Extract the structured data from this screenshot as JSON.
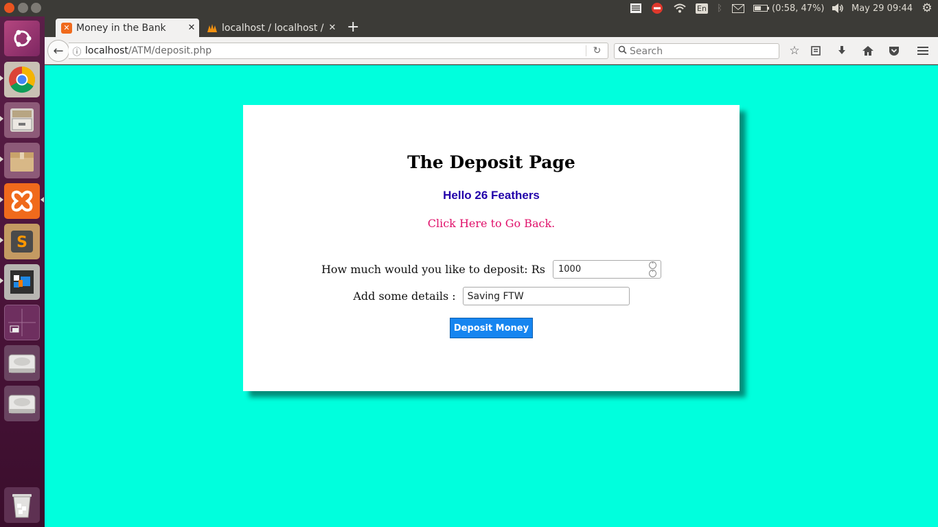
{
  "top_panel": {
    "keyboard_layout": "En",
    "battery": "(0:58, 47%)",
    "clock": "May 29 09:44"
  },
  "launcher": {
    "items": [
      {
        "name": "ubuntu-dash",
        "color": "#a83a74"
      },
      {
        "name": "chrome",
        "color": "#4a8be0"
      },
      {
        "name": "files",
        "color": "#9c9389"
      },
      {
        "name": "archive-manager",
        "color": "#c2a36c"
      },
      {
        "name": "xampp",
        "color": "#f06a1c"
      },
      {
        "name": "sublime-text",
        "color": "#4e4e4e"
      },
      {
        "name": "vm-app",
        "color": "#3c3c3c"
      },
      {
        "name": "workspaces",
        "color": "#6e2f5f"
      },
      {
        "name": "drive-1",
        "color": "#b9b8b6"
      },
      {
        "name": "drive-2",
        "color": "#b9b8b6"
      },
      {
        "name": "trash",
        "color": "#d9d8d6"
      }
    ]
  },
  "browser": {
    "tabs": [
      {
        "title": "Money in the Bank",
        "active": true
      },
      {
        "title": "localhost / localhost / ",
        "active": false
      }
    ],
    "new_tab_label": "+",
    "url_host": "localhost",
    "url_path": "/ATM/deposit.php",
    "search_placeholder": "Search"
  },
  "page": {
    "title": "The Deposit Page",
    "greeting": "Hello 26 Feathers",
    "back_link": "Click Here to Go Back.",
    "amount_label": "How much would you like to deposit: Rs",
    "amount_value": "1000",
    "details_label": "Add some details :",
    "details_value": "Saving FTW",
    "submit_label": "Deposit Money"
  },
  "colors": {
    "page_background": "#00ffdd",
    "greeting": "#2200aa",
    "link": "#e0106a",
    "button": "#1685f0"
  }
}
